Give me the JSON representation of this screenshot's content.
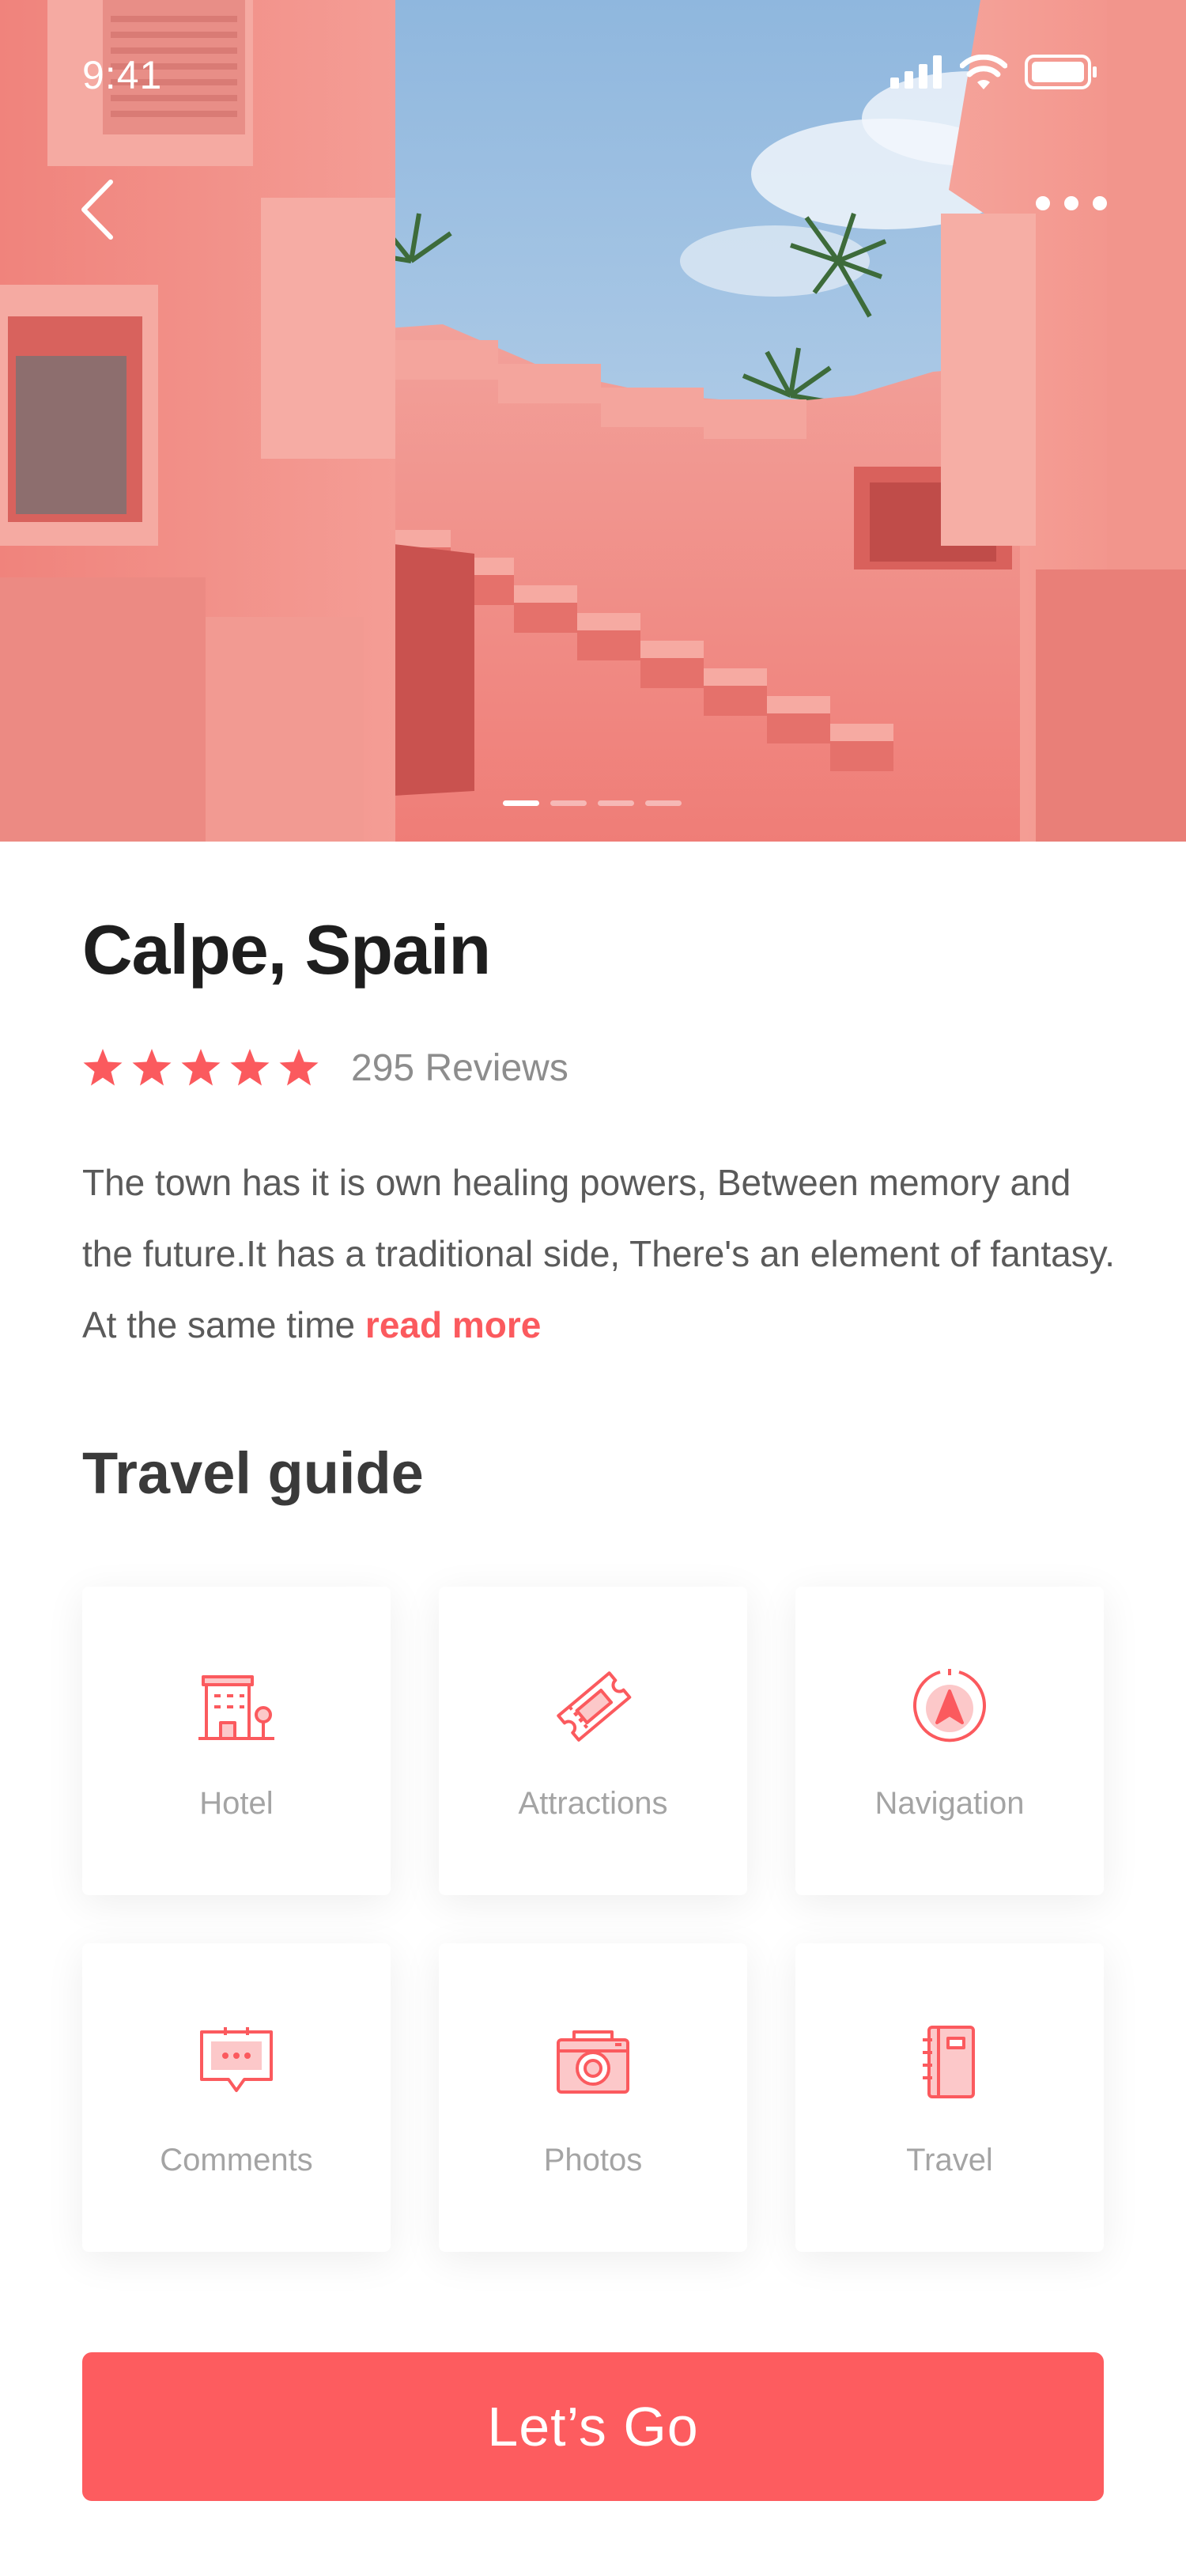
{
  "status_bar": {
    "time": "9:41"
  },
  "hero": {
    "icons": {
      "back": "chevron-left-icon",
      "more": "more-horizontal-icon"
    },
    "pager": {
      "count": 4,
      "active_index": 0
    }
  },
  "place": {
    "title": "Calpe, Spain",
    "rating": 5,
    "reviews_count": "295",
    "reviews_label": "Reviews",
    "description": "The town has it is own healing powers, Between memory and the future.It has a traditional side, There's an element of fantasy. At the same time ",
    "read_more": "read more"
  },
  "guide": {
    "title": "Travel guide",
    "items": [
      {
        "label": "Hotel",
        "icon": "hotel-icon"
      },
      {
        "label": "Attractions",
        "icon": "ticket-icon"
      },
      {
        "label": "Navigation",
        "icon": "compass-icon"
      },
      {
        "label": "Comments",
        "icon": "chat-bubble-icon"
      },
      {
        "label": "Photos",
        "icon": "camera-icon"
      },
      {
        "label": "Travel",
        "icon": "notebook-icon"
      }
    ]
  },
  "cta": {
    "label": "Let’s Go"
  },
  "colors": {
    "accent": "#FD5C5F",
    "title": "#1E1E1E",
    "muted": "#8D8D8D"
  }
}
